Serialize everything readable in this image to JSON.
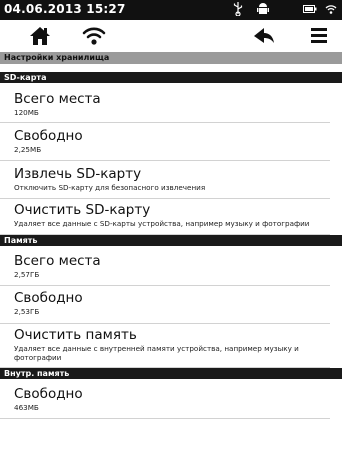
{
  "status_bar": {
    "datetime": "04.06.2013  15:27",
    "icons": [
      "usb-icon",
      "android-debug-icon",
      "battery-icon",
      "wifi-icon"
    ]
  },
  "toolbar": {
    "icons": [
      "home-icon",
      "wifi-icon",
      "back-icon",
      "menu-icon"
    ]
  },
  "header": {
    "title": "Настройки хранилища"
  },
  "sections": [
    {
      "label": "SD-карта",
      "items": [
        {
          "title": "Всего места",
          "subtitle": "120МБ"
        },
        {
          "title": "Свободно",
          "subtitle": "2,25МБ"
        },
        {
          "title": "Извлечь SD-карту",
          "subtitle": "Отключить SD-карту для безопасного извлечения"
        },
        {
          "title": "Очистить SD-карту",
          "subtitle": "Удаляет все данные с SD-карты устройства, например музыку и фотографии"
        }
      ]
    },
    {
      "label": "Память",
      "items": [
        {
          "title": "Всего места",
          "subtitle": "2,57ГБ"
        },
        {
          "title": "Свободно",
          "subtitle": "2,53ГБ"
        },
        {
          "title": "Очистить память",
          "subtitle": "Удаляет все данные с внутренней памяти устройства, например музыку и фотографии"
        }
      ]
    },
    {
      "label": "Внутр. память",
      "items": [
        {
          "title": "Свободно",
          "subtitle": "463МБ"
        }
      ]
    }
  ]
}
